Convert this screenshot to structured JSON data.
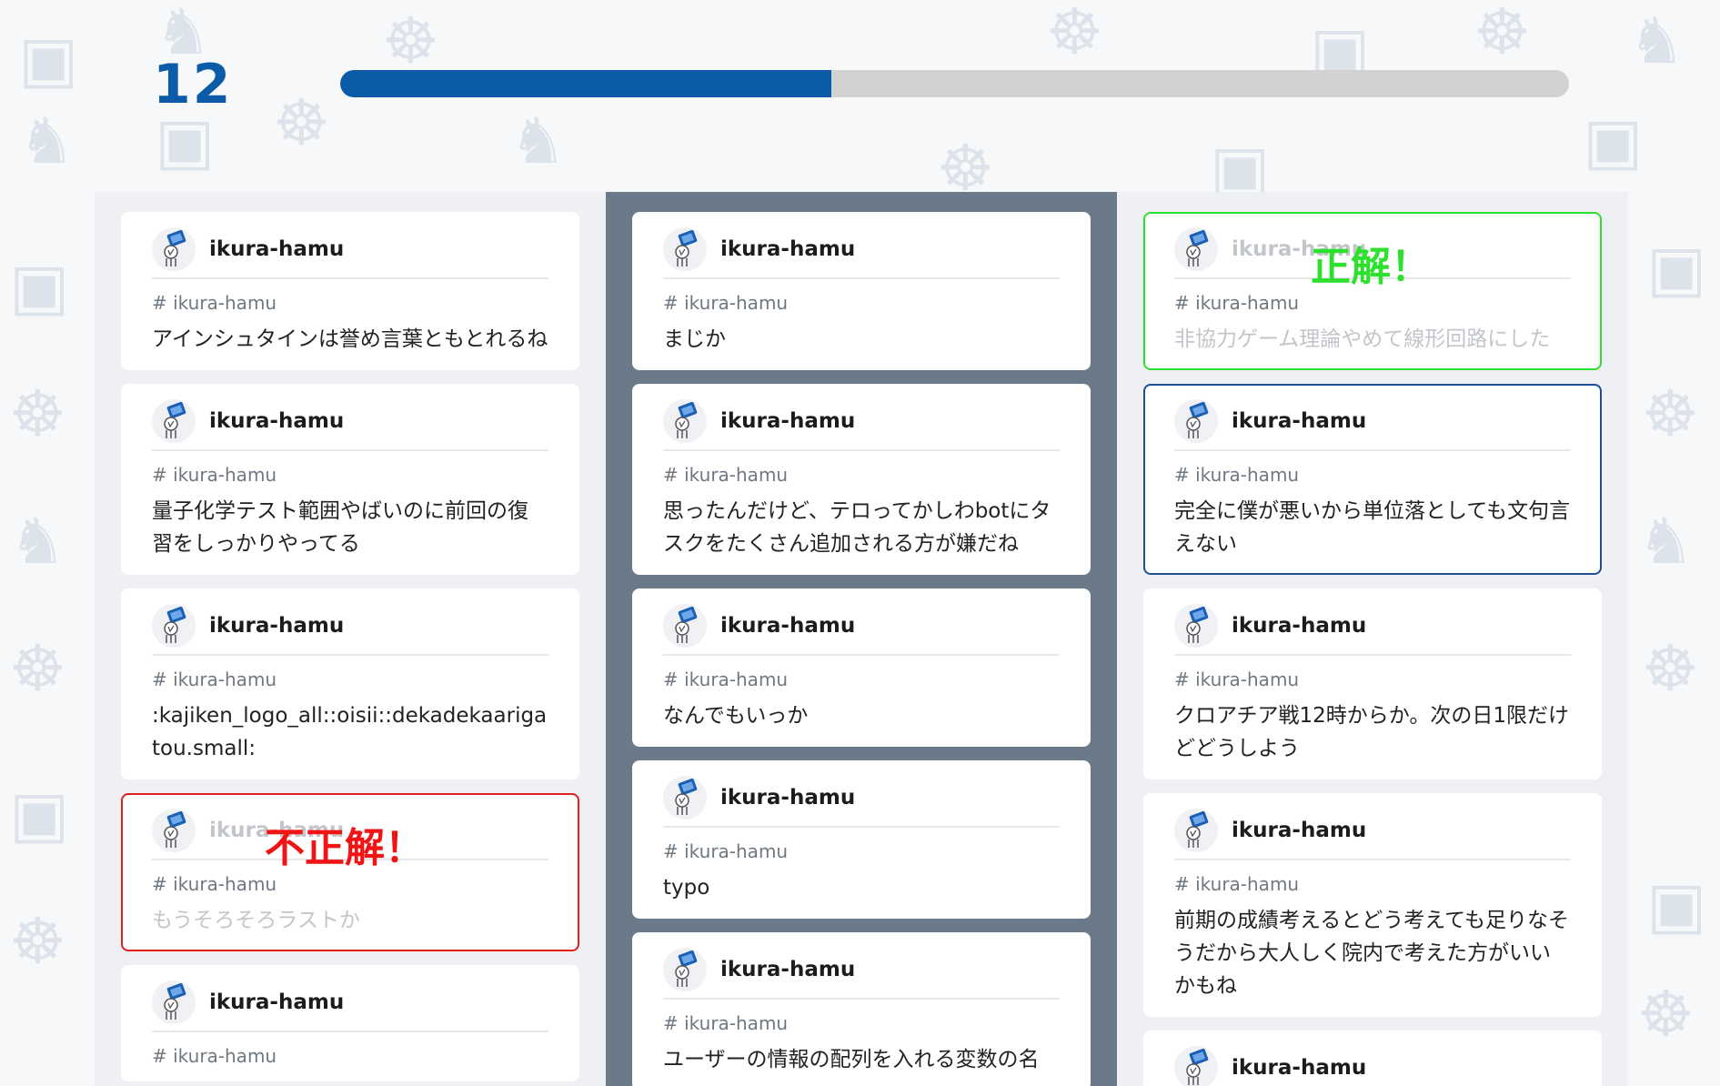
{
  "progress": {
    "count": "12",
    "fraction": 0.4
  },
  "colors": {
    "accent": "#0b5ba8",
    "correct": "#2ee02e",
    "incorrect": "#e02020",
    "selected": "#1d4f94",
    "highlight_column": "#6b7a88"
  },
  "columns": [
    {
      "cards": [
        {
          "user": "ikura-hamu",
          "channel": "# ikura-hamu",
          "text": "アインシュタインは誉め言葉ともとれるね",
          "state": "normal",
          "verdict": ""
        },
        {
          "user": "ikura-hamu",
          "channel": "# ikura-hamu",
          "text": "量子化学テスト範囲やばいのに前回の復習をしっかりやってる",
          "state": "normal",
          "verdict": ""
        },
        {
          "user": "ikura-hamu",
          "channel": "# ikura-hamu",
          "text": ":kajiken_logo_all::oisii::dekadekaarigatou.small:",
          "state": "normal",
          "verdict": ""
        },
        {
          "user": "ikura-hamu",
          "channel": "# ikura-hamu",
          "text": "もうそろそろラストか",
          "state": "incorrect",
          "verdict": "不正解！"
        },
        {
          "user": "ikura-hamu",
          "channel": "# ikura-hamu",
          "text": "",
          "state": "normal",
          "verdict": ""
        }
      ]
    },
    {
      "cards": [
        {
          "user": "ikura-hamu",
          "channel": "# ikura-hamu",
          "text": "まじか",
          "state": "normal",
          "verdict": ""
        },
        {
          "user": "ikura-hamu",
          "channel": "# ikura-hamu",
          "text": "思ったんだけど、テロってかしわbotにタスクをたくさん追加される方が嫌だね",
          "state": "normal",
          "verdict": ""
        },
        {
          "user": "ikura-hamu",
          "channel": "# ikura-hamu",
          "text": "なんでもいっか",
          "state": "normal",
          "verdict": ""
        },
        {
          "user": "ikura-hamu",
          "channel": "# ikura-hamu",
          "text": "typo",
          "state": "normal",
          "verdict": ""
        },
        {
          "user": "ikura-hamu",
          "channel": "# ikura-hamu",
          "text": "ユーザーの情報の配列を入れる変数の名",
          "state": "normal",
          "verdict": ""
        }
      ]
    },
    {
      "cards": [
        {
          "user": "ikura-hamu",
          "channel": "# ikura-hamu",
          "text": "非協力ゲーム理論やめて線形回路にした",
          "state": "correct",
          "verdict": "正解！"
        },
        {
          "user": "ikura-hamu",
          "channel": "# ikura-hamu",
          "text": "完全に僕が悪いから単位落としても文句言えない",
          "state": "selected",
          "verdict": ""
        },
        {
          "user": "ikura-hamu",
          "channel": "# ikura-hamu",
          "text": "クロアチア戦12時からか。次の日1限だけどどうしよう",
          "state": "normal",
          "verdict": ""
        },
        {
          "user": "ikura-hamu",
          "channel": "# ikura-hamu",
          "text": "前期の成績考えるとどう考えても足りなそうだから大人しく院内で考えた方がいいかもね",
          "state": "normal",
          "verdict": ""
        },
        {
          "user": "ikura-hamu",
          "channel": "",
          "text": "",
          "state": "normal",
          "verdict": ""
        }
      ]
    }
  ]
}
